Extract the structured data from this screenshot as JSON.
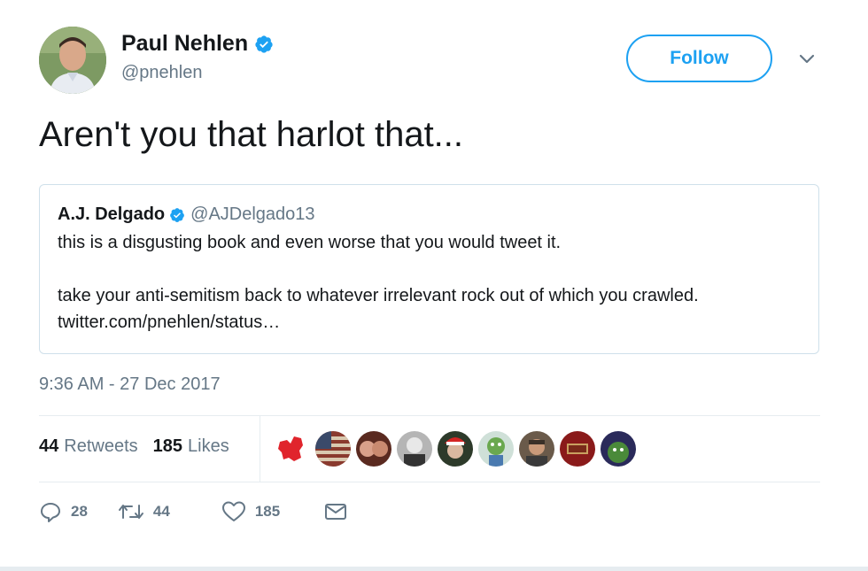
{
  "author": {
    "name": "Paul Nehlen",
    "handle": "@pnehlen"
  },
  "follow_button_label": "Follow",
  "tweet_text": "Aren't you that harlot that...",
  "quoted": {
    "name": "A.J. Delgado",
    "handle": "@AJDelgado13",
    "lines": [
      "this is a disgusting book and even worse that you would tweet it.",
      "take your anti-semitism back to whatever irrelevant rock out of which you crawled.",
      "twitter.com/pnehlen/status…"
    ]
  },
  "timestamp": "9:36 AM - 27 Dec 2017",
  "stats": {
    "retweets_count": "44",
    "retweets_label": "Retweets",
    "likes_count": "185",
    "likes_label": "Likes"
  },
  "actions": {
    "reply_count": "28",
    "retweet_count": "44",
    "like_count": "185"
  },
  "icons": [
    "verified-badge",
    "chevron-down-icon",
    "reply-icon",
    "retweet-icon",
    "heart-icon",
    "mail-icon"
  ],
  "colors": {
    "accent": "#1da1f2",
    "muted": "#657786",
    "text": "#14171a",
    "border": "#e6ecf0"
  }
}
